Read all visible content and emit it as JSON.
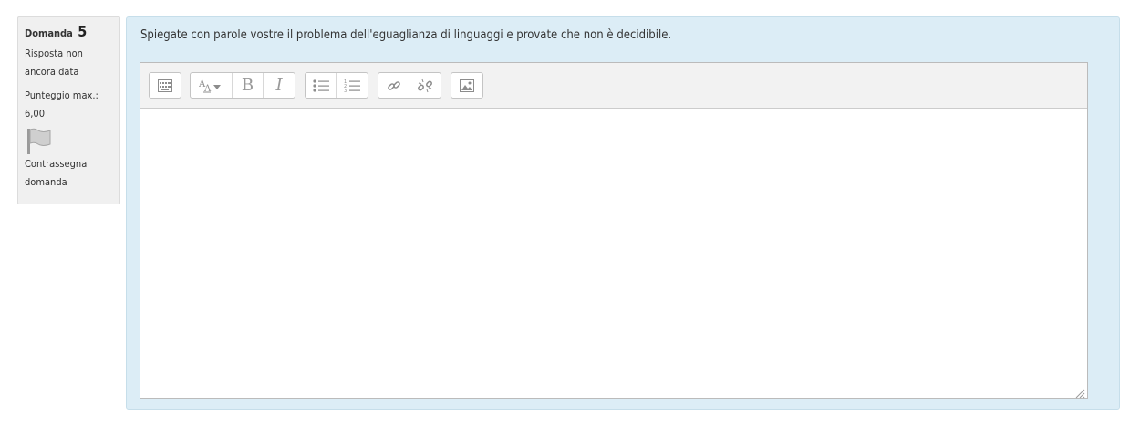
{
  "question_info": {
    "label": "Domanda",
    "number": "5",
    "state": "Risposta non ancora data",
    "grade": "Punteggio max.: 6,00",
    "flag_label": "Contrassegna domanda"
  },
  "question": {
    "text": "Spiegate con parole vostre il problema dell'eguaglianza di linguaggi e provate che non è decidibile."
  },
  "editor": {
    "toolbar": [
      [
        "toolbar-toggle-icon"
      ],
      [
        "font-style-dropdown-icon",
        "bold-icon",
        "italic-icon"
      ],
      [
        "unordered-list-icon",
        "ordered-list-icon"
      ],
      [
        "link-icon",
        "unlink-icon"
      ],
      [
        "insert-image-icon"
      ]
    ],
    "content": ""
  }
}
